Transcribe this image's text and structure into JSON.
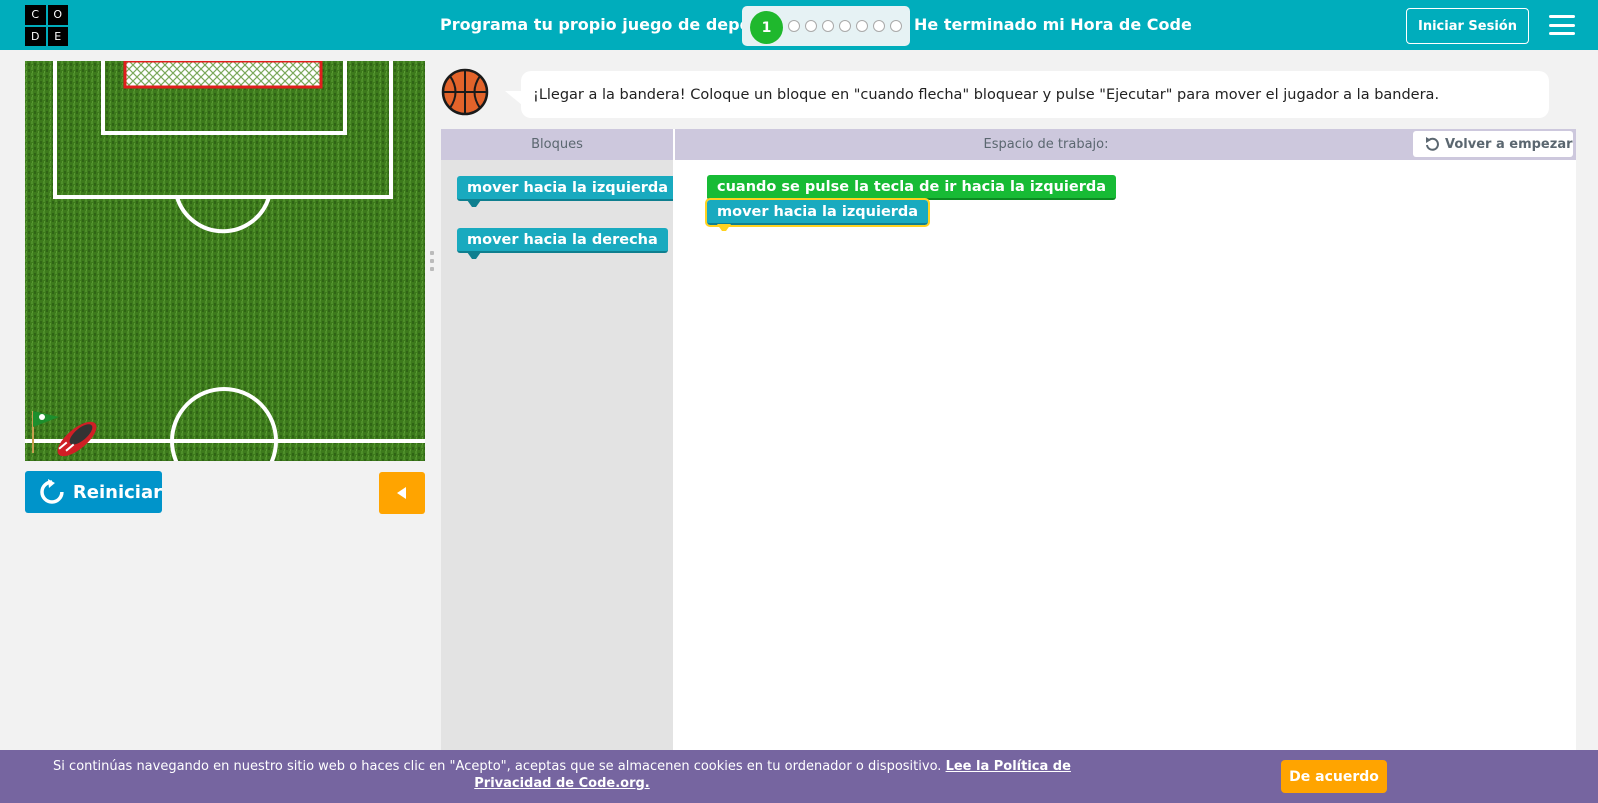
{
  "header": {
    "logo_letters": [
      "C",
      "O",
      "D",
      "E"
    ],
    "title": "Programa tu propio juego de deporte",
    "progress": {
      "current": "1",
      "total_levels": 8
    },
    "finish_link": "He terminado mi Hora de Code",
    "signin_label": "Iniciar Sesión",
    "menu_icon": "hamburger-icon"
  },
  "game": {
    "reset_label": "Reiniciar",
    "reset_icon": "refresh-icon",
    "step_icon": "triangle-left-icon",
    "colors": {
      "grass": "#3f7a1f",
      "lines": "#ffffff",
      "goal": "#e01e1e"
    }
  },
  "instructions": {
    "avatar_icon": "basketball-icon",
    "text": "¡Llegar a la bandera! Coloque un bloque en \"cuando flecha\" bloquear y pulse \"Ejecutar\" para mover el jugador a la bandera."
  },
  "workspace_header": {
    "toolbox_label": "Bloques",
    "workspace_label": "Espacio de trabajo:",
    "restart_label": "Volver a empezar",
    "restart_icon": "undo-icon"
  },
  "toolbox": {
    "blocks": [
      "mover hacia la izquierda",
      "mover hacia la derecha"
    ]
  },
  "workspace": {
    "event_block": "cuando se pulse la tecla de ir hacia la izquierda",
    "child_block": "mover hacia la izquierda"
  },
  "cookie": {
    "text": "Si continúas navegando en nuestro sitio web o haces clic en \"Acepto\", aceptas que se almacenen cookies en tu ordenador o dispositivo. ",
    "link": "Lee la Política de Privacidad de Code.org.",
    "accept_label": "De acuerdo"
  }
}
